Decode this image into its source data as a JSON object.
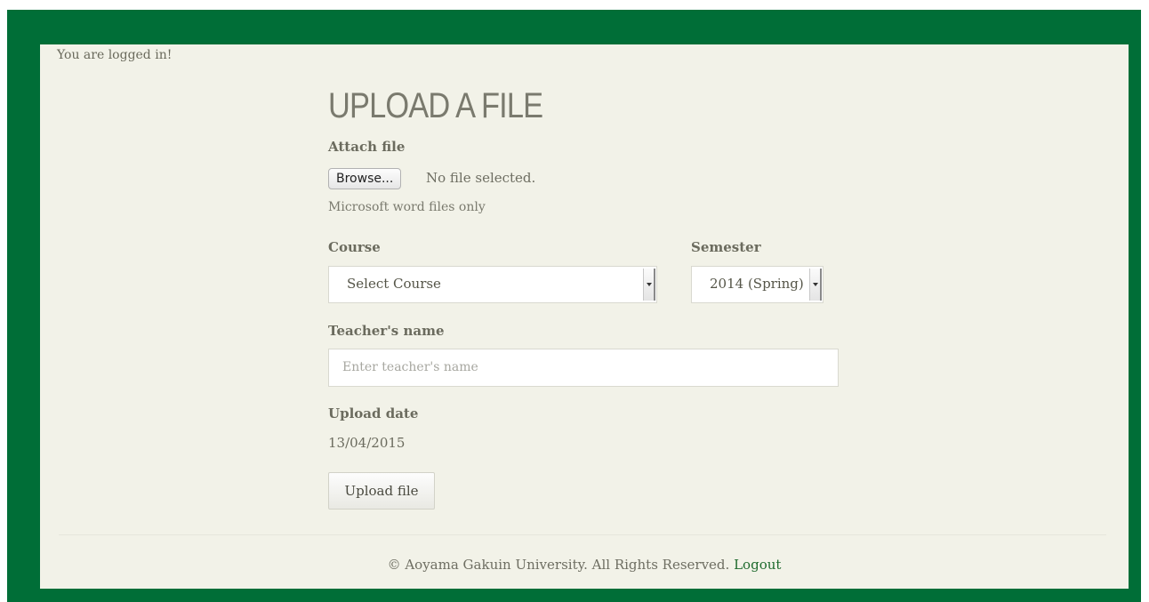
{
  "status": {
    "logged_in": "You are logged in!"
  },
  "form": {
    "title": "UPLOAD A FILE",
    "attach_label": "Attach file",
    "browse_label": "Browse...",
    "file_status": "No file selected.",
    "file_help": "Microsoft word files only",
    "course_label": "Course",
    "course_value": "Select Course",
    "semester_label": "Semester",
    "semester_value": "2014 (Spring)",
    "teacher_label": "Teacher's name",
    "teacher_placeholder": "Enter teacher's name",
    "date_label": "Upload date",
    "date_value": "13/04/2015",
    "submit_label": "Upload file"
  },
  "footer": {
    "copyright": "© Aoyama Gakuin University. All Rights Reserved.",
    "logout_label": "Logout"
  },
  "colors": {
    "frame": "#006e37",
    "panel": "#f2f2e8",
    "link": "#1f6b2e"
  },
  "icons": {
    "dropdown": "chevron-down-icon"
  }
}
